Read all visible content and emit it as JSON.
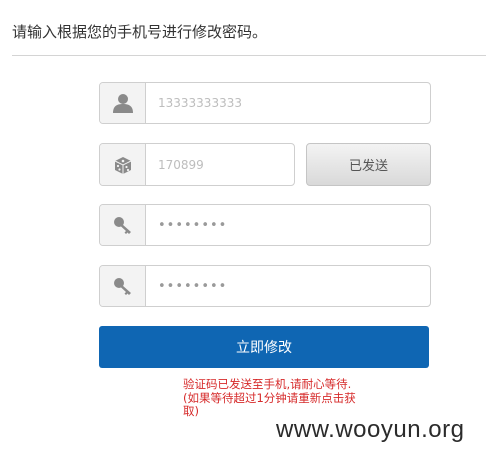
{
  "page": {
    "title": "请输入根据您的手机号进行修改密码。"
  },
  "form": {
    "phone": {
      "value": "13333333333",
      "icon": "user-icon"
    },
    "code": {
      "value": "170899",
      "icon": "dice-icon",
      "send_button_label": "已发送"
    },
    "password": {
      "value": "••••••••",
      "icon": "key-icon"
    },
    "confirm_password": {
      "value": "••••••••",
      "icon": "key-icon"
    },
    "submit_label": "立即修改"
  },
  "notice": {
    "line1": "验证码已发送至手机,请耐心等待.",
    "line2": "(如果等待超过1分钟请重新点击获取)"
  },
  "watermark": "www.wooyun.org",
  "colors": {
    "primary": "#0f66b3",
    "notice": "#d62a2a",
    "icon": "#8a8a8a"
  }
}
